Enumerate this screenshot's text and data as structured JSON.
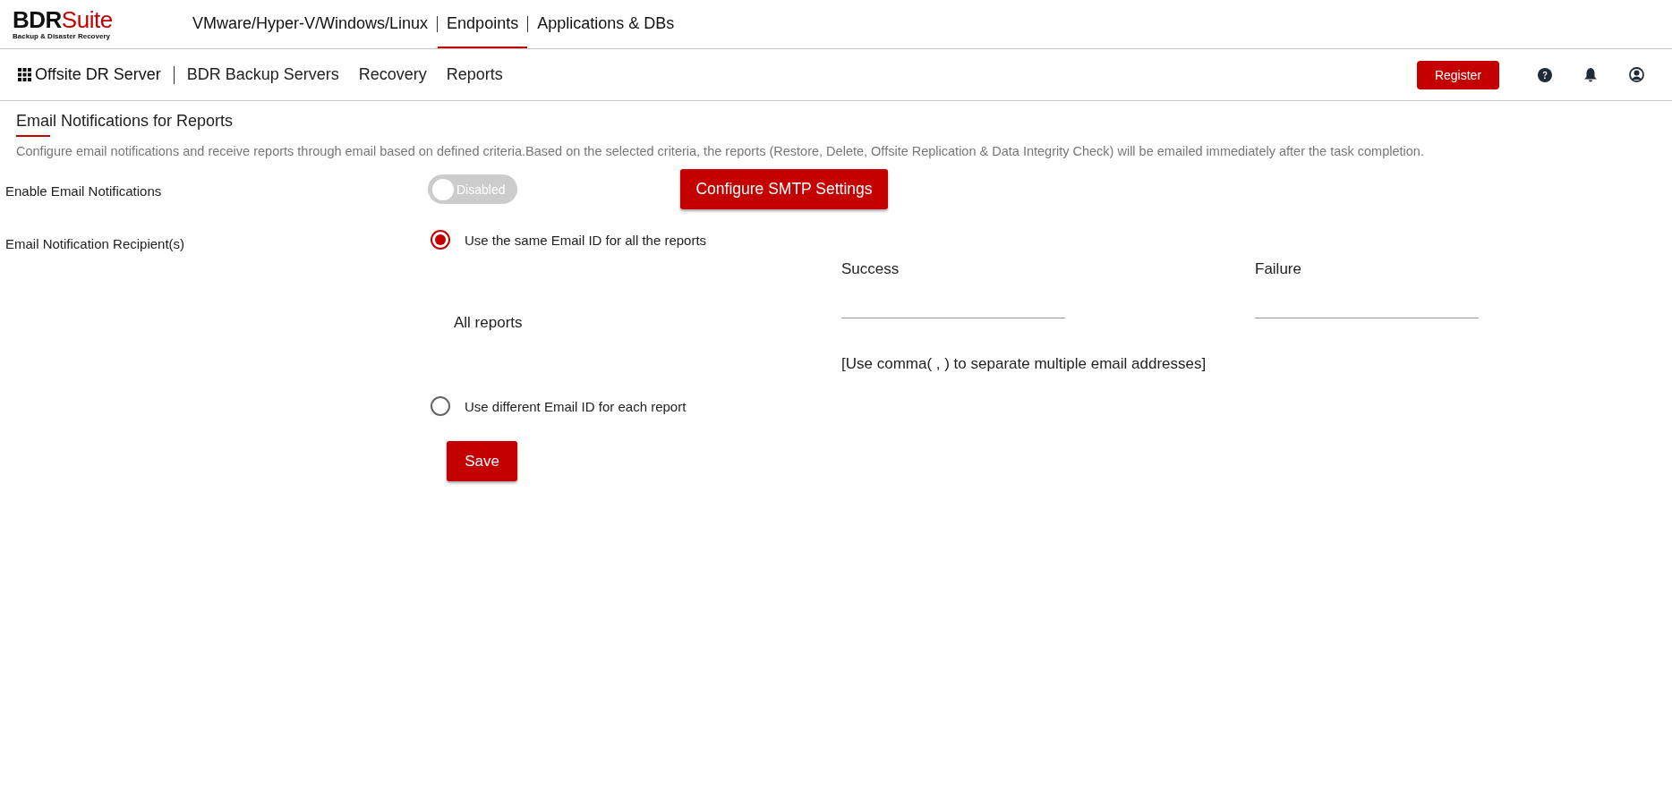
{
  "logo": {
    "brand": "BDR",
    "suffix": "Suite",
    "tagline": "Backup & Disaster Recovery"
  },
  "top_tabs": [
    {
      "label": "VMware/Hyper-V/Windows/Linux",
      "selected": false
    },
    {
      "label": "Endpoints",
      "selected": true
    },
    {
      "label": "Applications & DBs",
      "selected": false
    }
  ],
  "sub_nav": {
    "title": "Offsite DR Server",
    "items": [
      "BDR Backup Servers",
      "Recovery",
      "Reports"
    ],
    "register": "Register"
  },
  "page": {
    "title": "Email Notifications for Reports",
    "description": "Configure email notifications and receive reports through email based on defined criteria.Based on the selected criteria, the reports (Restore, Delete, Offsite Replication & Data Integrity Check) will be emailed immediately after the task completion."
  },
  "enable": {
    "label": "Enable Email Notifications",
    "on": false,
    "state_text": "Disabled",
    "smtp_button": "Configure SMTP Settings"
  },
  "recipients": {
    "label": "Email Notification Recipient(s)",
    "options": [
      {
        "label": "Use the same Email ID for all the reports",
        "selected": true
      },
      {
        "label": "Use different Email ID for each report",
        "selected": false
      }
    ],
    "row_label": "All reports",
    "columns": [
      "Success",
      "Failure"
    ],
    "hint": "[Use comma( , ) to separate multiple email addresses]"
  },
  "save": "Save"
}
